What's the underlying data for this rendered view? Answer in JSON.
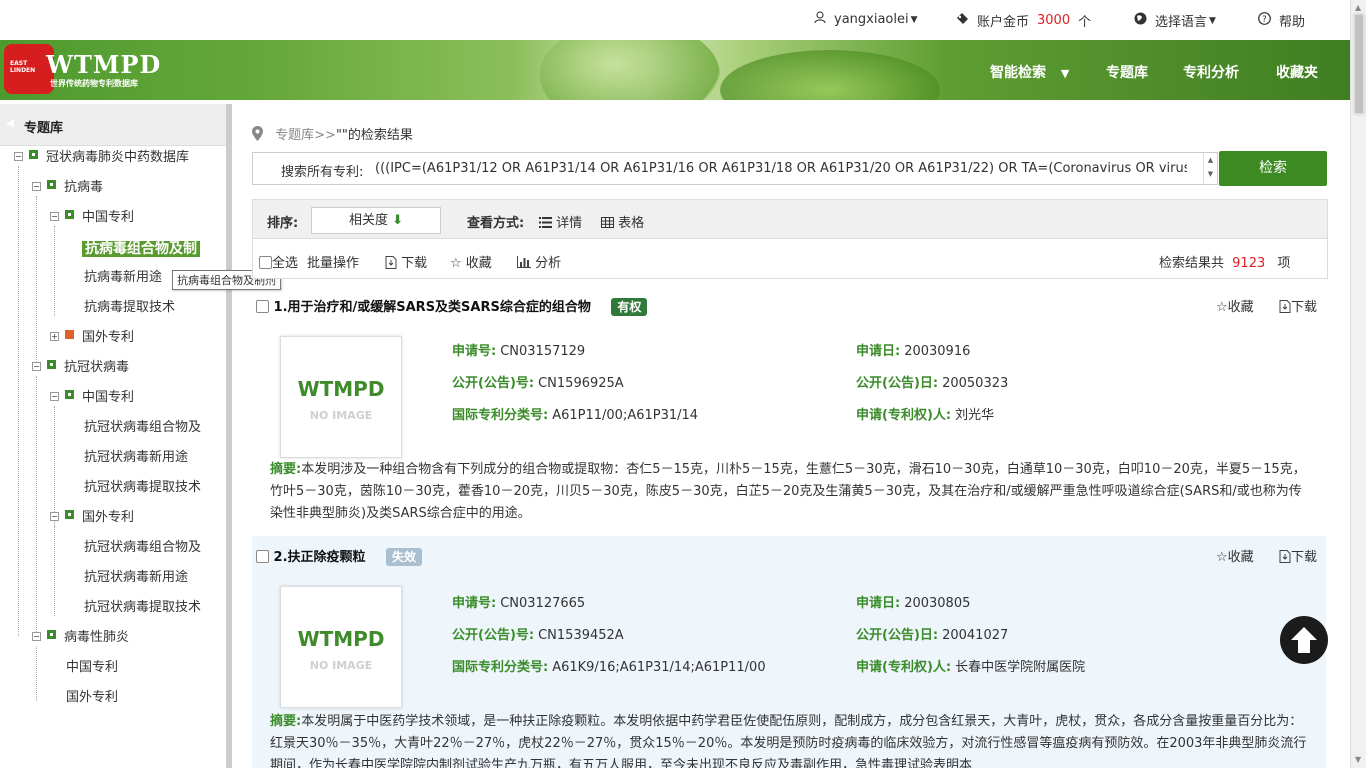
{
  "topbar": {
    "username": "yangxiaolei",
    "coins_label": "账户金币",
    "coins_value": "3000",
    "coins_unit": "个",
    "language_label": "选择语言",
    "help_label": "帮助"
  },
  "header": {
    "logo_text": "EAST LINDEN",
    "brand": "WTMPD",
    "brand_sub": "世界传统药物专利数据库",
    "nav": [
      "智能检索",
      "专题库",
      "专利分析",
      "收藏夹"
    ]
  },
  "sidebar": {
    "title": "专题库",
    "tree": {
      "root": "冠状病毒肺炎中药数据库",
      "antiviral": "抗病毒",
      "cn_patent": "中国专利",
      "antiviral_cn_selected": "抗病毒组合物及制",
      "antiviral_cn_new_use": "抗病毒新用途",
      "antiviral_cn_extract": "抗病毒提取技术",
      "foreign_patent": "国外专利",
      "anti_corona": "抗冠状病毒",
      "anti_corona_cn": "中国专利",
      "corona_cn_comp": "抗冠状病毒组合物及",
      "corona_cn_new_use": "抗冠状病毒新用途",
      "corona_cn_extract": "抗冠状病毒提取技术",
      "anti_corona_foreign": "国外专利",
      "corona_fr_comp": "抗冠状病毒组合物及",
      "corona_fr_new_use": "抗冠状病毒新用途",
      "corona_fr_extract": "抗冠状病毒提取技术",
      "viral_pneumonia": "病毒性肺炎",
      "vp_cn": "中国专利",
      "vp_foreign": "国外专利"
    },
    "tooltip": "抗病毒组合物及制剂"
  },
  "main": {
    "breadcrumb_link": "专题库>>",
    "breadcrumb_rest": "\"\"的检索结果",
    "search_label": "搜索所有专利:",
    "search_query": "(((IPC=(A61P31/12 OR A61P31/14 OR A61P31/16 OR A61P31/18 OR A61P31/20 OR A61P31/22) OR TA=(Coronavirus OR virus",
    "search_button": "检索",
    "sort_label": "排序:",
    "sort_value": "相关度",
    "view_label": "查看方式:",
    "view_detail": "详情",
    "view_table": "表格",
    "select_all": "全选",
    "batch_ops": "批量操作",
    "download": "下载",
    "favorite": "收藏",
    "analyze": "分析",
    "result_count_prefix": "检索结果共",
    "result_count": "9123",
    "result_count_suffix": "项"
  },
  "field_labels": {
    "app_no": "申请号:",
    "app_date": "申请日:",
    "pub_no": "公开(公告)号:",
    "pub_date": "公开(公告)日:",
    "ipc": "国际专利分类号:",
    "applicant": "申请(专利权)人:",
    "abstract": "摘要:",
    "favorite": "收藏",
    "download": "下载"
  },
  "results": [
    {
      "title": "1.用于治疗和/或缓解SARS及类SARS综合症的组合物",
      "status": "有权",
      "thumb_brand": "WTMPD",
      "thumb_no_image": "NO IMAGE",
      "app_no": "CN03157129",
      "app_date": "20030916",
      "pub_no": "CN1596925A",
      "pub_date": "20050323",
      "ipc": "A61P11/00;A61P31/14",
      "applicant": "刘光华",
      "abstract": "本发明涉及一种组合物含有下列成分的组合物或提取物：杏仁5－15克，川朴5－15克，生薏仁5－30克，滑石10－30克，白通草10－30克，白叩10－20克，半夏5－15克，竹叶5－30克，茵陈10－30克，藿香10－20克，川贝5－30克，陈皮5－30克，白芷5－20克及生蒲黄5－30克，及其在治疗和/或缓解严重急性呼吸道综合症(SARS和/或也称为传染性非典型肺炎)及类SARS综合症中的用途。"
    },
    {
      "title": "2.扶正除疫颗粒",
      "status": "失效",
      "thumb_brand": "WTMPD",
      "thumb_no_image": "NO IMAGE",
      "app_no": "CN03127665",
      "app_date": "20030805",
      "pub_no": "CN1539452A",
      "pub_date": "20041027",
      "ipc": "A61K9/16;A61P31/14;A61P11/00",
      "applicant": "长春中医学院附属医院",
      "abstract": "本发明属于中医药学技术领域，是一种扶正除疫颗粒。本发明依据中药学君臣佐使配伍原则，配制成方，成分包含红景天，大青叶，虎杖，贯众，各成分含量按重量百分比为：红景天30％－35％，大青叶22％－27％，虎杖22％－27％，贯众15％－20％。本发明是预防时疫病毒的临床效验方，对流行性感冒等瘟疫病有预防效。在2003年非典型肺炎流行期间，作为长春中医学院院内制剂试验生产九万瓶，有五万人服用，至今未出现不良反应及毒副作用，急性毒理试验表明本"
    }
  ],
  "colors": {
    "accent_green": "#3d8a22",
    "count_red": "#e02020",
    "valid_badge": "#2f7a3a",
    "invalid_badge": "#aabfd0"
  },
  "icons": [
    "user-icon",
    "coin-icon",
    "globe-icon",
    "help-icon",
    "map-pin-icon",
    "arrow-down-icon",
    "list-icon",
    "table-icon",
    "file-download-icon",
    "star-icon",
    "bar-chart-icon",
    "back-to-top-icon"
  ]
}
